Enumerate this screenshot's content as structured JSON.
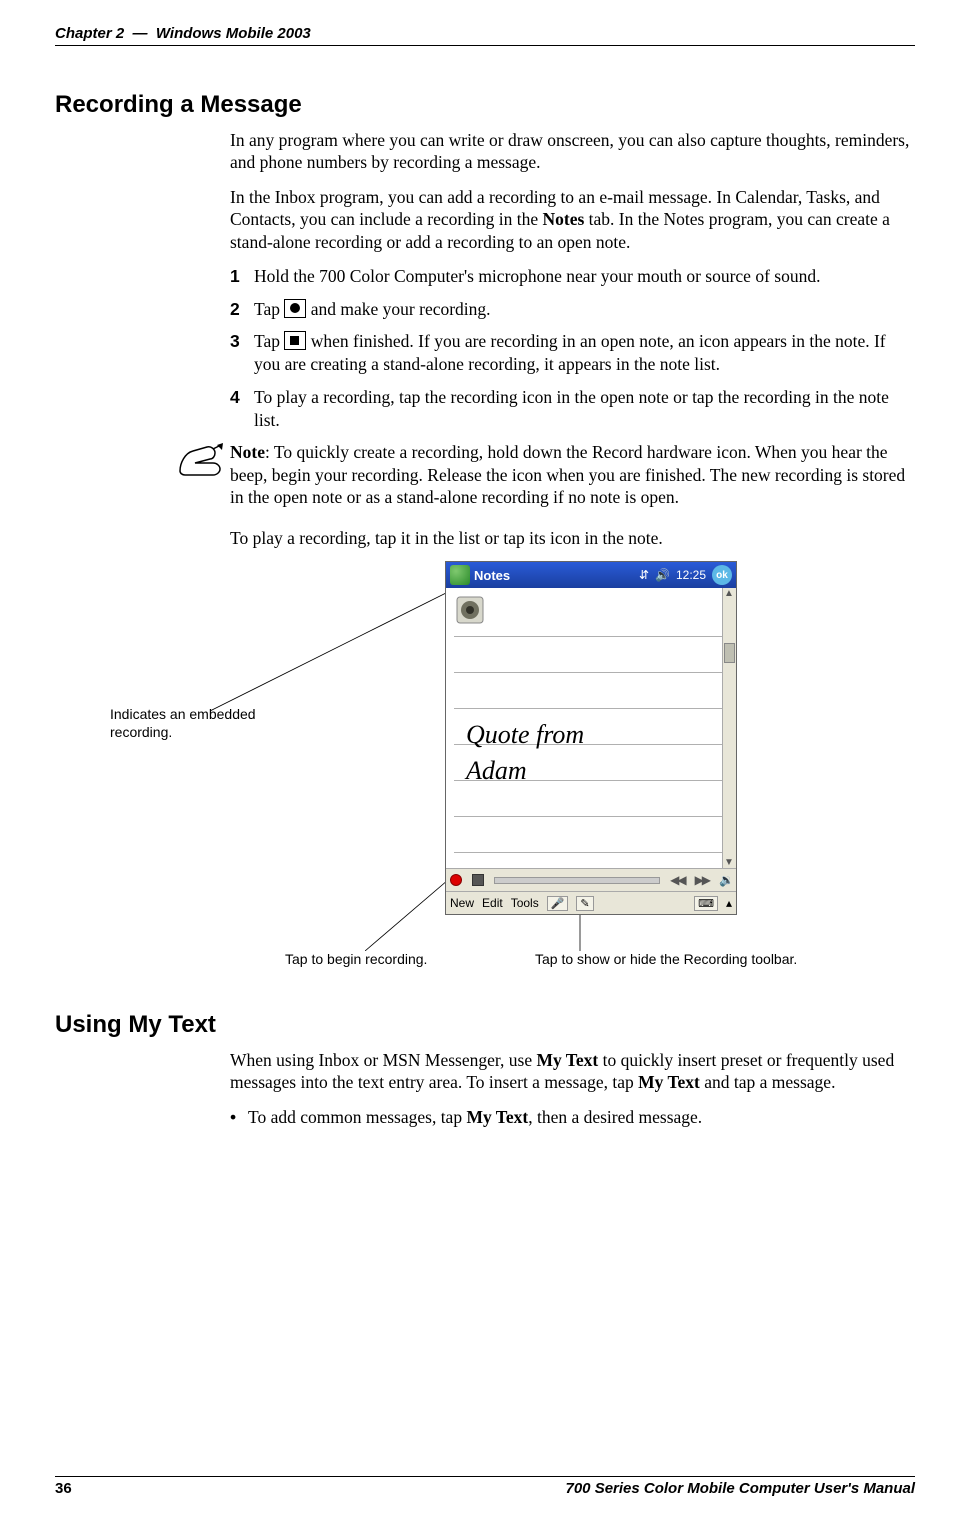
{
  "header": {
    "chapter": "Chapter 2",
    "sep": "—",
    "title": "Windows Mobile 2003"
  },
  "section1": {
    "heading": "Recording a Message",
    "para1": "In any program where you can write or draw onscreen, you can also capture thoughts, reminders, and phone numbers by recording a message.",
    "para2_a": "In the Inbox program, you can add a recording to an e-mail message. In Calendar, Tasks, and Contacts, you can include a recording in the ",
    "para2_bold": "Notes",
    "para2_b": " tab. In the Notes program, you can create a stand-alone recording or add a recording to an open note.",
    "steps": {
      "s1": "Hold the 700 Color Computer's microphone near your mouth or source of sound.",
      "s2a": "Tap ",
      "s2b": " and make your recording.",
      "s3a": "Tap ",
      "s3b": " when finished. If you are recording in an open note, an icon appears in the note. If you are creating a stand-alone recording, it appears in the note list.",
      "s4": "To play a recording, tap the recording icon in the open note or tap the recording in the note list."
    },
    "note": {
      "bold": "Note",
      "rest": ": To quickly create a recording, hold down the Record hardware icon. When you hear the beep, begin your recording. Release the icon when you are finished. The new recording is stored in the open note or as a stand-alone recording if no note is open."
    },
    "after_note": "To play a recording, tap it in the list or tap its icon in the note."
  },
  "figure": {
    "callout_embedded": "Indicates an embedded recording.",
    "callout_begin": "Tap to begin recording.",
    "callout_toolbar": "Tap to show or hide the Recording toolbar.",
    "titlebar_app": "Notes",
    "titlebar_time": "12:25",
    "handwriting_line1": "Quote from",
    "handwriting_line2": "Adam",
    "menu_new": "New",
    "menu_edit": "Edit",
    "menu_tools": "Tools",
    "ok": "ok"
  },
  "section2": {
    "heading": "Using My Text",
    "para1_a": "When using Inbox or MSN Messenger, use ",
    "para1_bold1": "My Text",
    "para1_b": " to quickly insert preset or frequently used messages into the text entry area. To insert a message, tap ",
    "para1_bold2": "My Text",
    "para1_c": " and tap a message.",
    "bullet1_a": "To add common messages, tap ",
    "bullet1_bold": "My Text",
    "bullet1_b": ", then a desired message."
  },
  "footer": {
    "page": "36",
    "manual": "700 Series Color Mobile Computer User's Manual"
  }
}
